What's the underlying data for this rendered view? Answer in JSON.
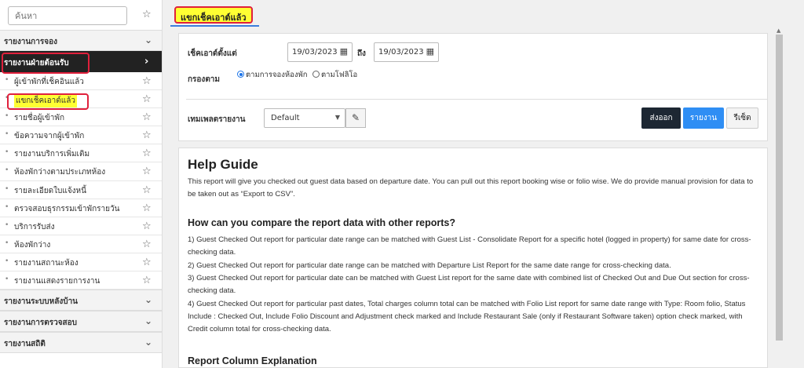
{
  "sidebar": {
    "search_placeholder": "ค้นหา",
    "groups": [
      {
        "label": "รายงานการจอง"
      },
      {
        "label": "รายงานฝ่ายต้อนรับ"
      },
      {
        "label": "รายงานระบบหลังบ้าน"
      },
      {
        "label": "รายงานการตรวจสอบ"
      },
      {
        "label": "รายงานสถิติ"
      }
    ],
    "items": [
      {
        "label": "ผู้เข้าพักที่เช็คอินแล้ว"
      },
      {
        "label": "แขกเช็คเอาต์แล้ว"
      },
      {
        "label": "รายชื่อผู้เข้าพัก"
      },
      {
        "label": "ข้อความจากผู้เข้าพัก"
      },
      {
        "label": "รายงานบริการเพิ่มเติม"
      },
      {
        "label": "ห้องพักว่างตามประเภทห้อง"
      },
      {
        "label": "รายละเอียดใบแจ้งหนี้"
      },
      {
        "label": "ตรวจสอบธุรกรรมเข้าพักรายวัน"
      },
      {
        "label": "บริการรับส่ง"
      },
      {
        "label": "ห้องพักว่าง"
      },
      {
        "label": "รายงานสถานะห้อง"
      },
      {
        "label": "รายงานแสดงรายการงาน"
      }
    ]
  },
  "tab": {
    "label": "แขกเช็คเอาต์แล้ว"
  },
  "filters": {
    "checkout_from_label": "เช็คเอาต์ตั้งแต่",
    "from_date": "19/03/2023",
    "to_label": "ถึง",
    "to_date": "19/03/2023",
    "filter_by_label": "กรองตาม",
    "radio_booking": "ตามการจองห้องพัก",
    "radio_folio": "ตามโฟลิโอ",
    "template_label": "เทมเพลตรายงาน",
    "template_value": "Default"
  },
  "actions": {
    "export": "ส่งออก",
    "report": "รายงาน",
    "reset": "รีเซ็ต"
  },
  "help": {
    "title": "Help Guide",
    "intro": "This report will give you checked out guest data based on departure date. You can pull out this report booking wise or folio wise. We do provide manual provision for data to be taken out as “Export to CSV”.",
    "compare_heading": "How can you compare the report data with other reports?",
    "points": [
      "1) Guest Checked Out report for particular date range can be matched with Guest List - Consolidate Report for a specific hotel (logged in property) for same date for cross-checking data.",
      "2) Guest Checked Out report for particular date range can be matched with Departure List Report for the same date range for cross-checking data.",
      "3) Guest Checked Out report for particular date can be matched with Guest List report for the same date with combined list of Checked Out and Due Out section for cross-checking data.",
      "4) Guest Checked Out report for particular past dates, Total charges column total can be matched with Folio List report for same date range with Type: Room folio, Status Include : Checked Out, Include Folio Discount and Adjustment check marked and Include Restaurant Sale (only if Restaurant Software taken) option check marked, with Credit column total for cross-checking data."
    ],
    "columns_heading": "Report Column Explanation"
  },
  "colors": {
    "accent": "#2f8ef4",
    "highlight": "#ffff33",
    "annotation": "#e0203c",
    "dark": "#1d2733"
  }
}
